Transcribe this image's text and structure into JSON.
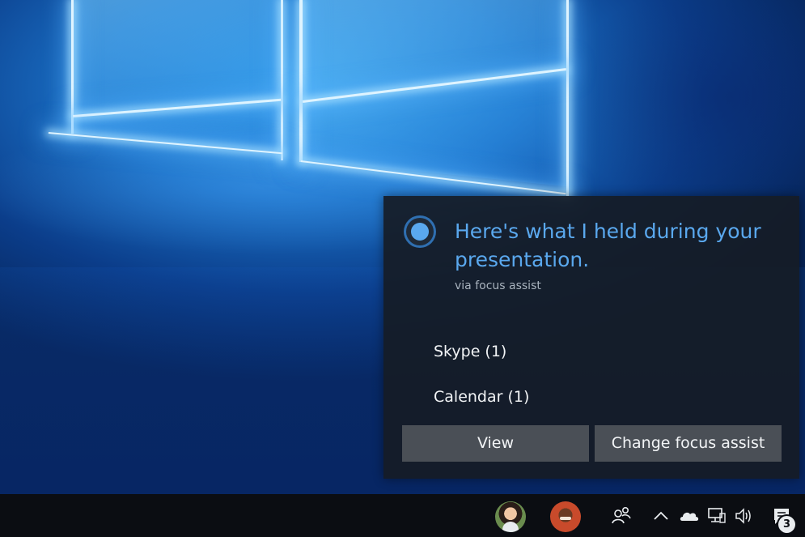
{
  "notification": {
    "title": "Here's what I held during your presentation.",
    "source": "via focus assist",
    "held_items": [
      {
        "label": "Skype (1)"
      },
      {
        "label": "Calendar (1)"
      }
    ],
    "buttons": {
      "view": "View",
      "change": "Change focus assist"
    },
    "accent_color": "#5aa8ee"
  },
  "taskbar": {
    "pinned_people": [
      {
        "icon": "contact-avatar"
      },
      {
        "icon": "contact-avatar"
      }
    ],
    "tray_icons": [
      "people-icon",
      "chevron-up-icon",
      "onedrive-icon",
      "network-icon",
      "volume-icon",
      "action-center-icon"
    ],
    "action_center_badge": "3"
  }
}
